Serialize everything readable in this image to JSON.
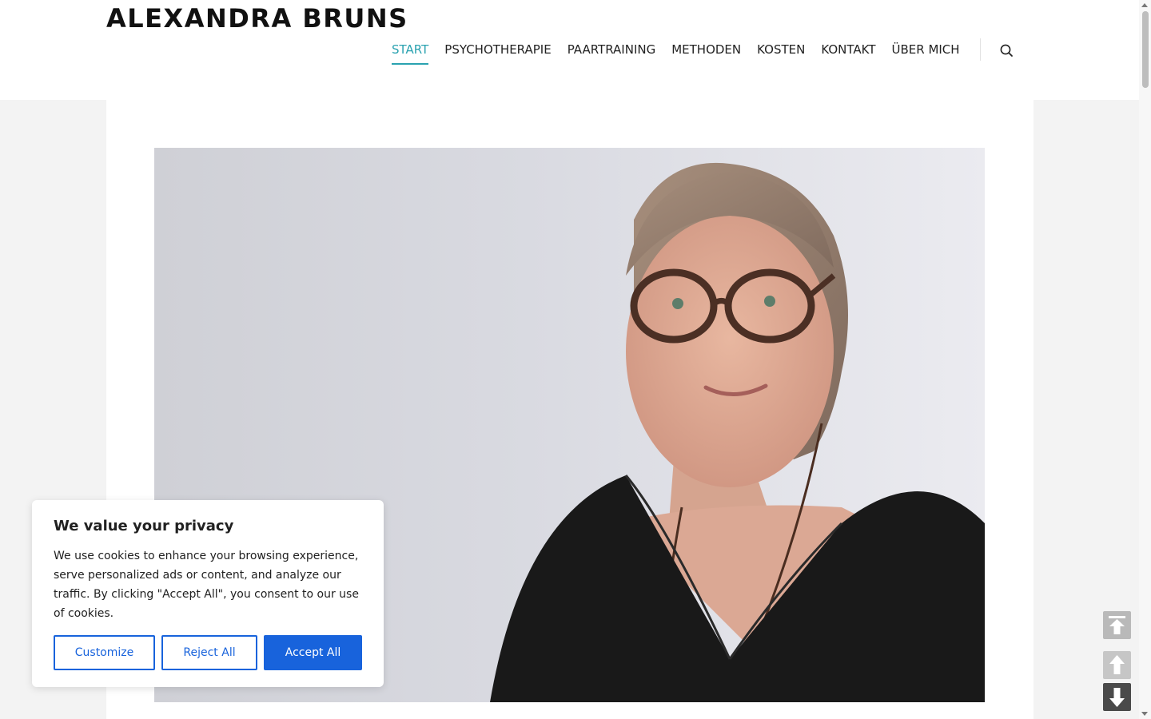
{
  "site": {
    "title": "ALEXANDRA BRUNS"
  },
  "nav": {
    "items": [
      {
        "label": "START",
        "active": true
      },
      {
        "label": "PSYCHOTHERAPIE",
        "active": false
      },
      {
        "label": "PAARTRAINING",
        "active": false
      },
      {
        "label": "METHODEN",
        "active": false
      },
      {
        "label": "KOSTEN",
        "active": false
      },
      {
        "label": "KONTAKT",
        "active": false
      },
      {
        "label": "ÜBER MICH",
        "active": false
      }
    ],
    "search_icon": "search-icon",
    "accent_color": "#2aa2b0"
  },
  "hero": {
    "image_icon": "portrait-photo"
  },
  "cookie_banner": {
    "title": "We value your privacy",
    "text": "We use cookies to enhance your browsing experience, serve personalized ads or content, and analyze our traffic. By clicking \"Accept All\", you consent to our use of cookies.",
    "customize_label": "Customize",
    "reject_label": "Reject All",
    "accept_label": "Accept All",
    "button_color": "#1863dc"
  },
  "scroll_buttons": [
    "scroll-to-top-icon",
    "scroll-up-icon",
    "scroll-down-icon"
  ]
}
